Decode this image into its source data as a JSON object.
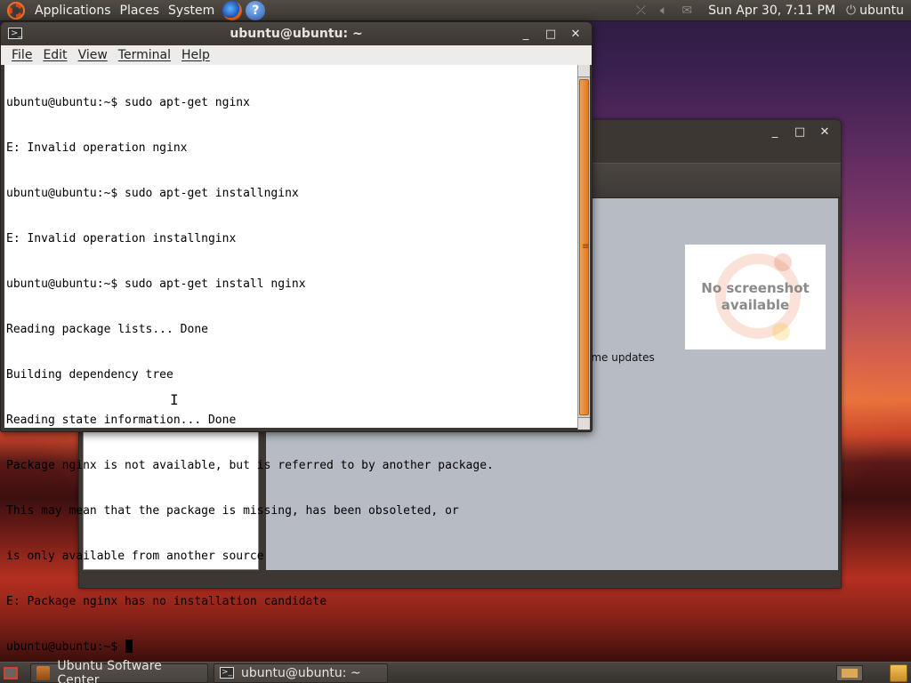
{
  "top_panel": {
    "menus": [
      "Applications",
      "Places",
      "System"
    ],
    "clock": "Sun Apr 30,  7:11 PM",
    "user": "ubuntu"
  },
  "software_center": {
    "window_buttons": [
      "_",
      "□",
      "✕"
    ],
    "updates_fragment": "ome updates",
    "no_screenshot_line1": "No screenshot",
    "no_screenshot_line2": "available"
  },
  "terminal": {
    "title": "ubuntu@ubuntu: ~",
    "window_buttons": [
      "_",
      "□",
      "✕"
    ],
    "menus": [
      "File",
      "Edit",
      "View",
      "Terminal",
      "Help"
    ],
    "lines": [
      "ubuntu@ubuntu:~$ sudo apt-get nginx",
      "E: Invalid operation nginx",
      "ubuntu@ubuntu:~$ sudo apt-get installnginx",
      "E: Invalid operation installnginx",
      "ubuntu@ubuntu:~$ sudo apt-get install nginx",
      "Reading package lists... Done",
      "Building dependency tree",
      "Reading state information... Done",
      "Package nginx is not available, but is referred to by another package.",
      "This may mean that the package is missing, has been obsoleted, or",
      "is only available from another source",
      "E: Package nginx has no installation candidate"
    ],
    "prompt": "ubuntu@ubuntu:~$ "
  },
  "taskbar": {
    "tasks": [
      "Ubuntu Software Center",
      "ubuntu@ubuntu: ~"
    ]
  },
  "icons": {
    "main_menu": "ubuntu-logo-icon",
    "browser": "firefox-icon",
    "help": "help-icon",
    "network": "network-icon",
    "volume": "volume-icon",
    "mail": "mail-icon",
    "power": "power-icon"
  },
  "colors": {
    "accent": "#dd4814",
    "panel": "#3c3833",
    "scrollbar_thumb": "#e07a26"
  }
}
